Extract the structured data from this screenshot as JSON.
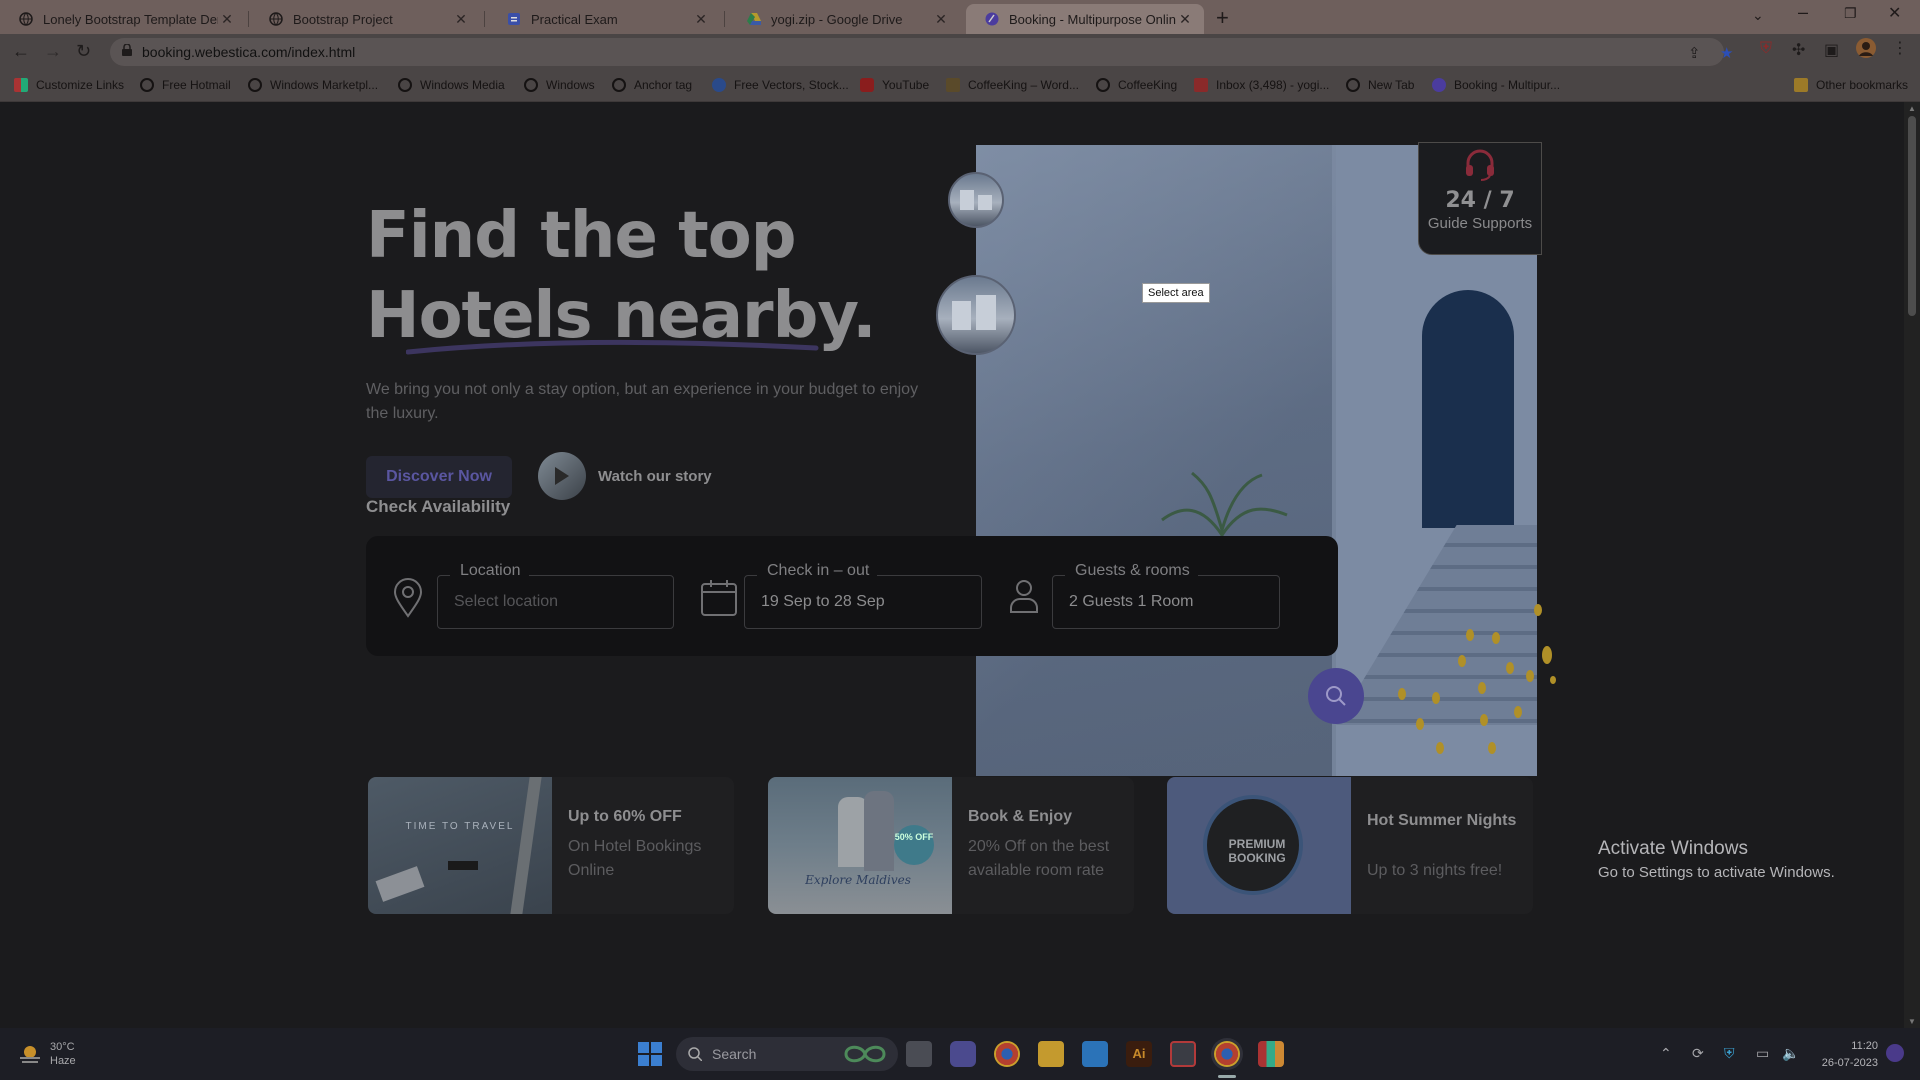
{
  "tabs": [
    {
      "title": "Lonely Bootstrap Template Demo",
      "active": false
    },
    {
      "title": "Bootstrap Project",
      "active": false
    },
    {
      "title": "Practical Exam",
      "active": false
    },
    {
      "title": "yogi.zip - Google Drive",
      "active": false
    },
    {
      "title": "Booking - Multipurpose Online Bo",
      "active": true
    }
  ],
  "address": {
    "url": "booking.webestica.com/index.html"
  },
  "bookmarks": [
    "Customize Links",
    "Free Hotmail",
    "Windows Marketpl...",
    "Windows Media",
    "Windows",
    "Anchor tag",
    "Free Vectors, Stock...",
    "YouTube",
    "CoffeeKing – Word...",
    "CoffeeKing",
    "Inbox (3,498) - yogi...",
    "New Tab",
    "Booking - Multipur..."
  ],
  "other_bookmarks": "Other bookmarks",
  "hero": {
    "line1": "Find the top",
    "line2": "Hotels nearby",
    "period": ".",
    "subtext": "We bring you not only a stay option, but an experience in your budget to enjoy the luxury.",
    "discover_label": "Discover Now",
    "watch_label": "Watch our story"
  },
  "support": {
    "headline": "24 / 7",
    "caption": "Guide Supports"
  },
  "tooltip": "Select area",
  "availability": {
    "title": "Check Availability",
    "location": {
      "label": "Location",
      "placeholder": "Select location"
    },
    "dates": {
      "label": "Check in – out",
      "value": "19 Sep to 28 Sep"
    },
    "guests": {
      "label": "Guests & rooms",
      "value": "2 Guests 1 Room"
    }
  },
  "promos": [
    {
      "title": "Up to 60% OFF",
      "desc": "On Hotel Bookings Online",
      "img_text": "TIME TO TRAVEL"
    },
    {
      "title": "Book & Enjoy",
      "desc": "20% Off on the best available room rate",
      "img_text": "Explore Maldives",
      "img_badge": "50% OFF"
    },
    {
      "title": "Hot Summer Nights",
      "desc": "Up to 3 nights free!",
      "img_text": "PREMIUM BOOKING"
    }
  ],
  "activate": {
    "line1": "Activate Windows",
    "line2": "Go to Settings to activate Windows."
  },
  "taskbar": {
    "temperature": "30°C",
    "condition": "Haze",
    "search_label": "Search",
    "time": "11:20",
    "date": "26-07-2023"
  },
  "colors": {
    "accent": "#4a4690",
    "page_bg": "#1b1b1d",
    "chrome_tab": "#6e5f5c"
  }
}
